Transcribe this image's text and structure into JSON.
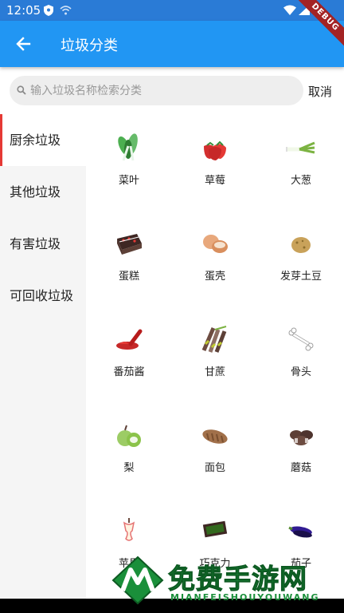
{
  "status": {
    "time": "12:05",
    "debug": "DEBUG",
    "icons": [
      "shield-icon",
      "cast-icon",
      "wifi-icon",
      "signal-icon",
      "battery-icon"
    ]
  },
  "app_bar": {
    "title": "垃圾分类",
    "back_icon": "arrow-left-icon",
    "color": "#2196f3"
  },
  "search": {
    "placeholder": "输入垃圾名称检索分类",
    "cancel_label": "取消"
  },
  "sidebar": {
    "active_color": "#e53935",
    "items": [
      {
        "label": "厨余垃圾",
        "active": true
      },
      {
        "label": "其他垃圾",
        "active": false
      },
      {
        "label": "有害垃圾",
        "active": false
      },
      {
        "label": "可回收垃圾",
        "active": false
      }
    ]
  },
  "grid": {
    "items": [
      {
        "label": "菜叶",
        "icon": "vegetable-leaf-icon"
      },
      {
        "label": "草莓",
        "icon": "strawberry-icon"
      },
      {
        "label": "大葱",
        "icon": "scallion-icon"
      },
      {
        "label": "蛋糕",
        "icon": "cake-icon"
      },
      {
        "label": "蛋壳",
        "icon": "eggshell-icon"
      },
      {
        "label": "发芽土豆",
        "icon": "sprouting-potato-icon"
      },
      {
        "label": "番茄酱",
        "icon": "ketchup-icon"
      },
      {
        "label": "甘蔗",
        "icon": "sugarcane-icon"
      },
      {
        "label": "骨头",
        "icon": "bone-icon"
      },
      {
        "label": "梨",
        "icon": "pear-icon"
      },
      {
        "label": "面包",
        "icon": "bread-icon"
      },
      {
        "label": "蘑菇",
        "icon": "mushroom-icon"
      },
      {
        "label": "苹果",
        "icon": "apple-core-icon"
      },
      {
        "label": "巧克力",
        "icon": "chocolate-icon"
      },
      {
        "label": "茄子",
        "icon": "eggplant-icon"
      }
    ]
  },
  "watermark": {
    "text": "免费手游网",
    "subtext": "MIANFEISHOUYOUWANG"
  }
}
